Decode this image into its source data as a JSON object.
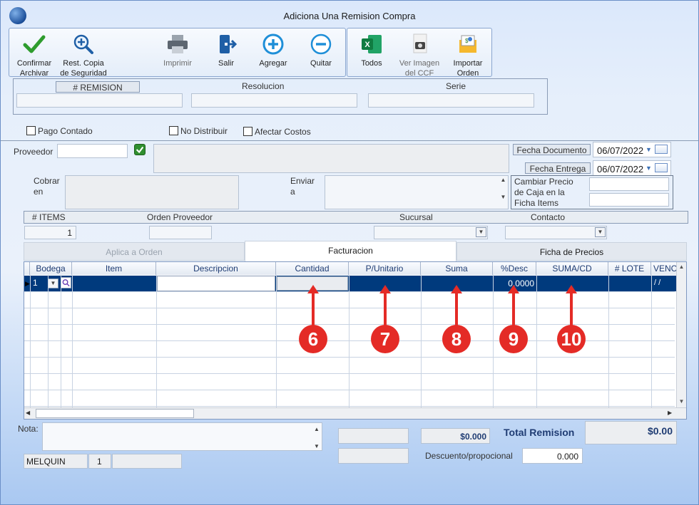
{
  "window": {
    "title": "Adiciona Una Remision Compra"
  },
  "toolbar": {
    "confirm": "Confirmar\nArchivar",
    "backup": "Rest. Copia\nde Seguridad",
    "print": "Imprimir",
    "exit": "Salir",
    "add": "Agregar",
    "remove": "Quitar",
    "excel": "Todos",
    "view_image": "Ver Imagen\ndel CCF",
    "import_order": "Importar\nOrden"
  },
  "header_fields": {
    "remision_label": "# REMISION",
    "resolucion_label": "Resolucion",
    "serie_label": "Serie",
    "remision": "",
    "resolucion": "",
    "serie": ""
  },
  "options": {
    "pago_contado": "Pago Contado",
    "no_distribuir": "No Distribuir",
    "afectar_costos": "Afectar Costos"
  },
  "proveedor": {
    "label": "Proveedor",
    "value": ""
  },
  "fecha_documento": {
    "label": "Fecha Documento",
    "value": "06/07/2022"
  },
  "fecha_entrega": {
    "label": "Fecha Entrega",
    "value": "06/07/2022"
  },
  "cobrar_label": "Cobrar\nen",
  "enviar_label": "Enviar\na",
  "cambiar_precio_label": "Cambiar Precio\nde Caja en la\nFicha Items",
  "items_bar": {
    "items_label": "# ITEMS",
    "orden_label": "Orden Proveedor",
    "sucursal_label": "Sucursal",
    "contacto_label": "Contacto",
    "items_value": "1"
  },
  "tabs": [
    {
      "label": "Aplica a Orden",
      "state": "disabled"
    },
    {
      "label": "Facturacion",
      "state": "active"
    },
    {
      "label": "Ficha de Precios",
      "state": "inactive"
    }
  ],
  "grid": {
    "columns": [
      "Bodega",
      "Item",
      "Descripcion",
      "Cantidad",
      "P/Unitario",
      "Suma",
      "%Desc",
      "SUMA/CD",
      "# LOTE",
      "VENC"
    ],
    "row": {
      "bodega": "1",
      "desc": "0.0000",
      "venc": "/  /"
    }
  },
  "markers": [
    "6",
    "7",
    "8",
    "9",
    "10"
  ],
  "footer": {
    "nota_label": "Nota:",
    "user": "MELQUIN",
    "user_num": "1",
    "subtotal": "$0.000",
    "total_label": "Total Remision",
    "total": "$0.00",
    "descuento_label": "Descuento/propocional",
    "descuento": "0.000"
  },
  "colors": {
    "selected_row": "#003a7d",
    "marker": "#e42b26",
    "grid_header_text": "#1f3c73"
  }
}
